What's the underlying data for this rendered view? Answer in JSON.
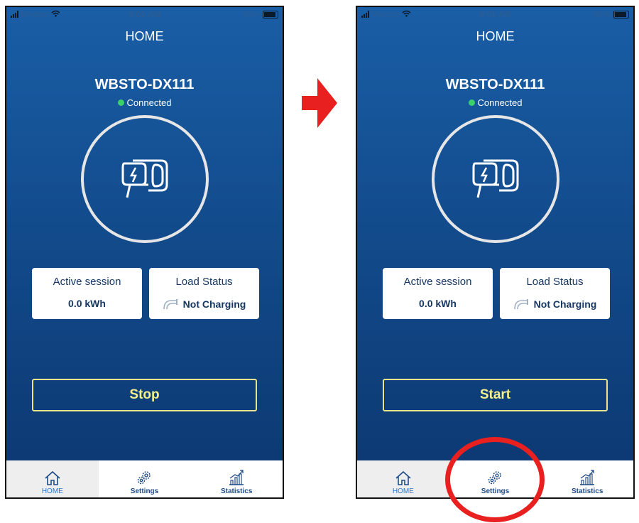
{
  "status_bar": {
    "carrier": "Verizon",
    "time": "9:01 AM",
    "battery": "86%"
  },
  "screen_title": "HOME",
  "device": {
    "name": "WBSTO-DX111",
    "connection": "Connected"
  },
  "cards": {
    "active_session": {
      "label": "Active session",
      "value": "0.0 kWh"
    },
    "load_status": {
      "label": "Load Status",
      "value": "Not Charging"
    }
  },
  "before": {
    "action_label": "Stop"
  },
  "after": {
    "action_label": "Start"
  },
  "tabs": [
    {
      "label": "HOME",
      "icon": "home-icon"
    },
    {
      "label": "Settings",
      "icon": "gear-icon"
    },
    {
      "label": "Statistics",
      "icon": "chart-icon"
    }
  ],
  "colors": {
    "background": "#124b8c",
    "accent_yellow": "#f2ef8c",
    "connected_green": "#3cd06a",
    "highlight_red": "#e8201f",
    "tab_active": "#2c78c9"
  }
}
